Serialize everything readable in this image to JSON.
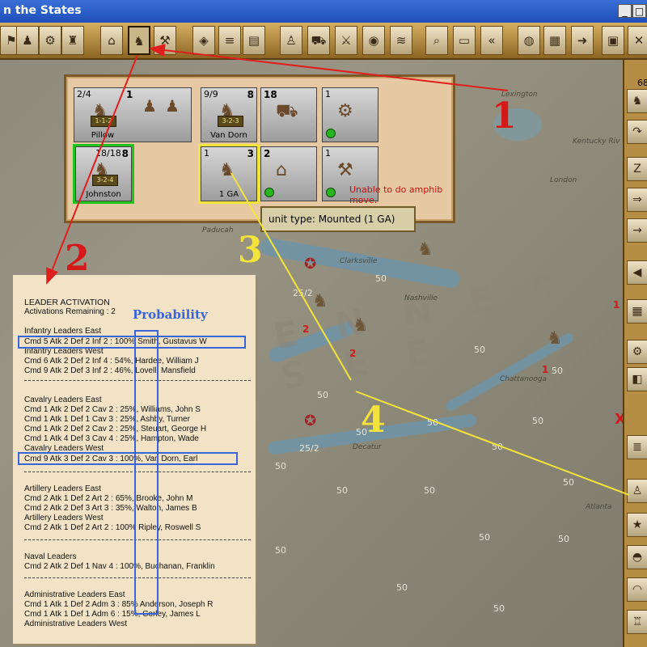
{
  "window": {
    "title": "n the States"
  },
  "unit_counters": [
    {
      "label": "Pillow",
      "strength": "2/4",
      "stack": "1",
      "rating": "1-1-2"
    },
    {
      "label": "Van Dorn",
      "strength": "9/9",
      "stack": "8",
      "rating": "3-2-3"
    },
    {
      "label": "",
      "strength": "18",
      "stack": ""
    },
    {
      "label": "",
      "strength": "1",
      "stack": ""
    },
    {
      "label": "Johnston",
      "strength": "18/18",
      "stack": "8",
      "rating": "3-2-4"
    },
    {
      "label": "1 GA",
      "strength": "1",
      "stack": "3"
    },
    {
      "label": "",
      "strength": "2",
      "stack": ""
    },
    {
      "label": "",
      "strength": "1",
      "stack": ""
    }
  ],
  "stack_message": "Unable to do amphib move.",
  "tooltip": "unit type: Mounted (1 GA)",
  "right_bar": {
    "count": "68"
  },
  "annotations": {
    "n1": "1",
    "n2": "2",
    "n3": "3",
    "n4": "4",
    "probability": "Probability"
  },
  "leader_panel": {
    "title": "LEADER ACTIVATION",
    "activations": "Activations Remaining : 2",
    "lines": [
      "Infantry Leaders East",
      "Cmd 5 Atk 2 Def 2 Inf 2 : 100%  Smith, Gustavus W",
      "Infantry Leaders West",
      "Cmd 6 Atk 2 Def 2 Inf 4 : 54%, Hardee, William J",
      "Cmd 9 Atk 2 Def 3 Inf 2 : 46%, Lovell, Mansfield",
      "Cavalry Leaders East",
      "Cmd 1 Atk 2 Def 2 Cav 2 : 25%, Williams, John S",
      "Cmd 1 Atk 1 Def 1 Cav 3 : 25%, Ashby, Turner",
      "Cmd 1 Atk 2 Def 2 Cav 2 : 25%, Steuart, George H",
      "Cmd 1 Atk 4 Def 3 Cav 4 : 25%, Hampton, Wade",
      "Cavalry Leaders West",
      "Cmd 9 Atk 3 Def 2 Cav 3 : 100%, Van Dorn, Earl",
      "Artillery Leaders East",
      "Cmd 2 Atk 1 Def 2 Art 2 : 65%, Brooke, John M",
      "Cmd 2 Atk 2 Def 3 Art 3 : 35%, Walton, James B",
      "Artillery Leaders West",
      "Cmd 2 Atk 1 Def 2 Art 2 : 100%  Ripley, Roswell S",
      "Naval Leaders",
      "Cmd 2 Atk 2 Def 1 Nav 4 : 100%, Buchanan, Franklin",
      "Administrative Leaders East",
      "Cmd 1 Atk 1 Def 2 Adm 3 : 85%  Anderson, Joseph R",
      "Cmd 1 Atk 1 Def 1 Adm 6 : 15%, Corley, James L",
      "Administrative Leaders West"
    ]
  },
  "map": {
    "numbers": [
      "50",
      "50",
      "50",
      "50",
      "50",
      "50",
      "50",
      "50",
      "50",
      "50",
      "50",
      "50",
      "50",
      "50",
      "50",
      "50",
      "50",
      "25/2",
      "25/2"
    ],
    "red_marks": [
      "2",
      "2",
      "1",
      "1",
      "X"
    ],
    "towns": [
      "Lexington",
      "Paducah",
      "Clarksville",
      "Nashville",
      "Chattanooga",
      "Decatur",
      "London",
      "Atlanta",
      "Kentucky Riv"
    ],
    "region": "E N N E S S E E"
  }
}
